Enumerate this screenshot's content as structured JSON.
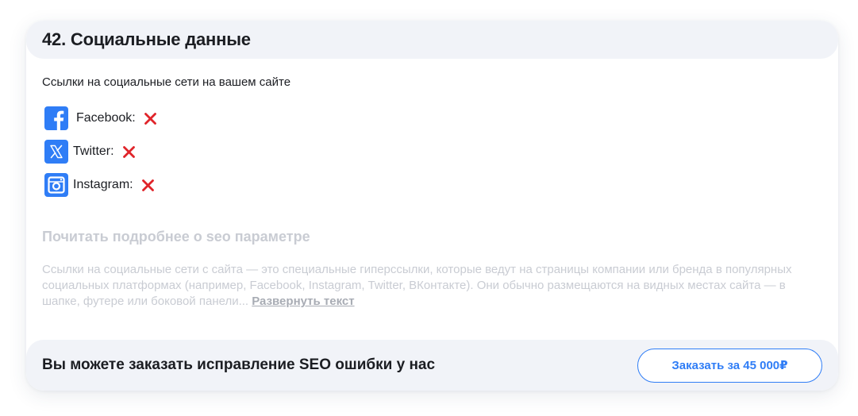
{
  "section": {
    "title": "42. Социальные данные",
    "intro": "Ссылки на социальные сети на вашем сайте"
  },
  "social_links": [
    {
      "name": "Facebook:",
      "icon": "facebook-icon",
      "status": "missing",
      "status_icon": "red-x-icon"
    },
    {
      "name": "Twitter:",
      "icon": "x-twitter-icon",
      "status": "missing",
      "status_icon": "red-x-icon"
    },
    {
      "name": "Instagram:",
      "icon": "instagram-icon",
      "status": "missing",
      "status_icon": "red-x-icon"
    }
  ],
  "details": {
    "heading": "Почитать подробнее о seo параметре",
    "text": "Ссылки на социальные сети с сайта — это специальные гиперссылки, которые ведут на страницы компании или бренда в популярных социальных платформах (например, Facebook, Instagram, Twitter, ВКонтакте). Они обычно размещаются на видных местах сайта — в шапке, футере или боковой панели... ",
    "expand_label": "Развернуть текст"
  },
  "footer": {
    "text": "Вы можете заказать исправление SEO ошибки у нас",
    "button_label": "Заказать за 45 000₽"
  },
  "colors": {
    "accent": "#2f7df6",
    "error": "#e0242a",
    "header_bg": "#f1f3f8",
    "muted_text": "#c9ccd3"
  }
}
